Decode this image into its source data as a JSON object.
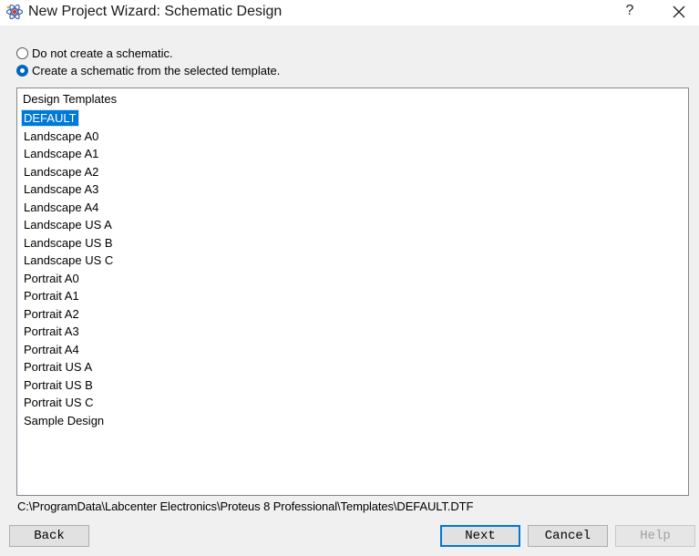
{
  "window": {
    "title": "New Project Wizard: Schematic Design",
    "help_glyph": "?",
    "app_icon": "proteus-atom-icon",
    "close_icon": "close-icon"
  },
  "options": {
    "no_schematic": "Do not create a schematic.",
    "from_template": "Create a schematic from the selected template.",
    "selected": "from_template"
  },
  "templates": {
    "header": "Design Templates",
    "selected": "DEFAULT",
    "items": [
      "DEFAULT",
      "Landscape A0",
      "Landscape A1",
      "Landscape A2",
      "Landscape A3",
      "Landscape A4",
      "Landscape US A",
      "Landscape US B",
      "Landscape US C",
      "Portrait A0",
      "Portrait A1",
      "Portrait A2",
      "Portrait A3",
      "Portrait A4",
      "Portrait US A",
      "Portrait US B",
      "Portrait US C",
      "Sample Design"
    ]
  },
  "path": "C:\\ProgramData\\Labcenter Electronics\\Proteus 8 Professional\\Templates\\DEFAULT.DTF",
  "buttons": {
    "back": "Back",
    "next": "Next",
    "cancel": "Cancel",
    "help": "Help"
  },
  "colors": {
    "selection": "#0078d7",
    "radio_accent": "#0067c0",
    "dialog_bg": "#f0f0f0"
  }
}
